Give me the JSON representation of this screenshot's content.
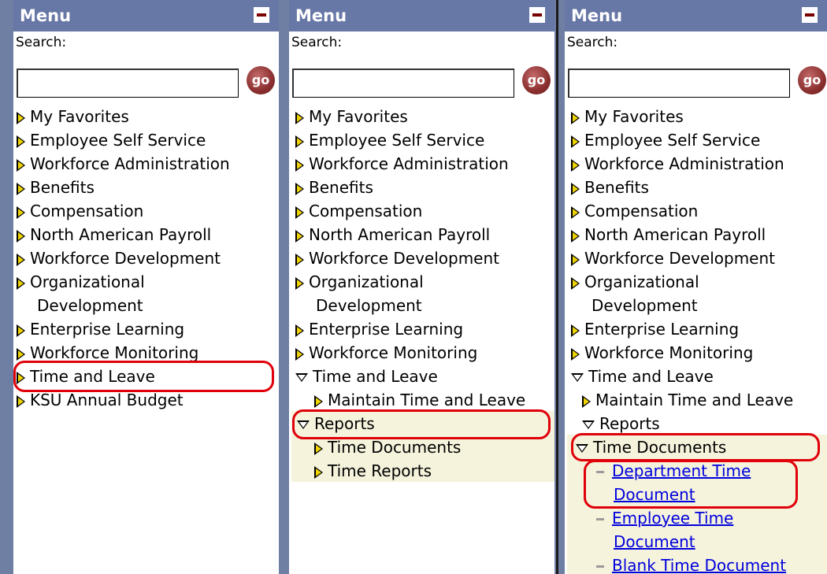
{
  "panels": [
    {
      "header": "Menu",
      "search_label": "Search:",
      "go_label": "go",
      "items": [
        "My Favorites",
        "Employee Self Service",
        "Workforce Administration",
        "Benefits",
        "Compensation",
        "North American Payroll",
        "Workforce Development",
        "Organizational",
        "Development",
        "Enterprise Learning",
        "Workforce Monitoring",
        "Time and Leave",
        "KSU Annual Budget"
      ]
    },
    {
      "header": "Menu",
      "search_label": "Search:",
      "go_label": "go",
      "items": [
        "My Favorites",
        "Employee Self Service",
        "Workforce Administration",
        "Benefits",
        "Compensation",
        "North American Payroll",
        "Workforce Development",
        "Organizational",
        "Development",
        "Enterprise Learning",
        "Workforce Monitoring",
        "Time and Leave",
        "Maintain Time and Leave",
        "Reports",
        "Time Documents",
        "Time Reports"
      ]
    },
    {
      "header": "Menu",
      "search_label": "Search:",
      "go_label": "go",
      "items": [
        "My Favorites",
        "Employee Self Service",
        "Workforce Administration",
        "Benefits",
        "Compensation",
        "North American Payroll",
        "Workforce Development",
        "Organizational",
        "Development",
        "Enterprise Learning",
        "Workforce Monitoring",
        "Time and Leave",
        "Maintain Time and Leave",
        "Reports",
        "Time Documents"
      ],
      "links": [
        "Department Time",
        "Document",
        "Employee Time",
        "Document",
        "Blank Time Document"
      ]
    }
  ],
  "colors": {
    "header_bg": "#6777a6",
    "annotation": "#e0000a",
    "submenu_bg": "#f5f3dc",
    "link": "#0000dd"
  }
}
